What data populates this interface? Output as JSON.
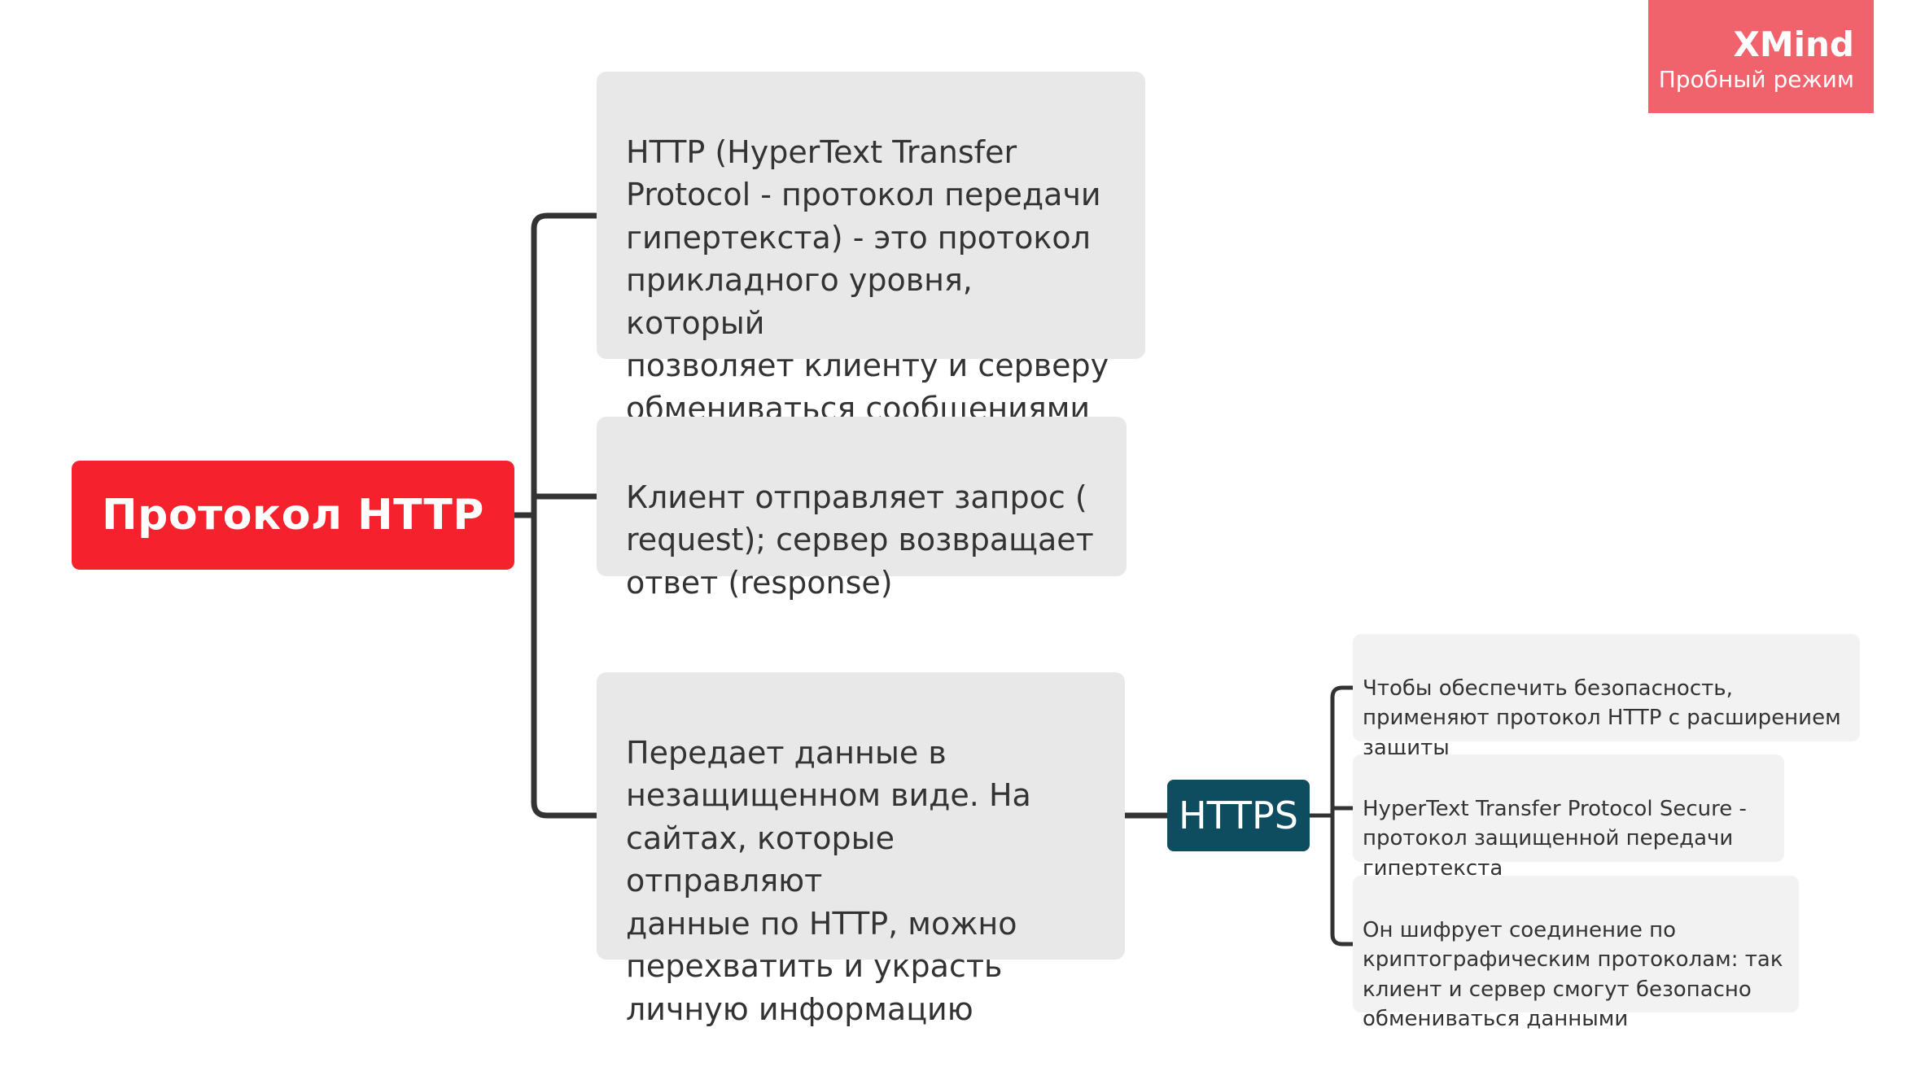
{
  "root": {
    "label": "Протокол HTTP",
    "color": "#f5222d"
  },
  "topics": [
    "HTTP (HyperText Transfer\nProtocol - протокол передачи\nгипертекста) - это протокол\nприкладного уровня, который\nпозволяет клиенту и серверу\nобмениваться сообщениями",
    "Клиент отправляет запрос (\nrequest); сервер возвращает\nответ (response)",
    "Передает данные в\nнезащищенном виде. На\nсайтах, которые отправляют\nданные по HTTP, можно\nперехватить и украсть\nличную информацию"
  ],
  "https": {
    "label": "HTTPS",
    "color": "#0d4d5f"
  },
  "subtopics": [
    "Чтобы обеспечить безопасность,\nприменяют протокол HTTP с расширением\nзащиты",
    "HyperText Transfer Protocol Secure -\nпротокол защищенной передачи\nгипертекста",
    "Он шифрует соединение по\nкриптографическим протоколам: так\nклиент и сервер смогут безопасно\nобмениваться данными"
  ],
  "watermark": {
    "brand": "XMind",
    "mode": "Пробный режим",
    "color": "#f0636d"
  }
}
